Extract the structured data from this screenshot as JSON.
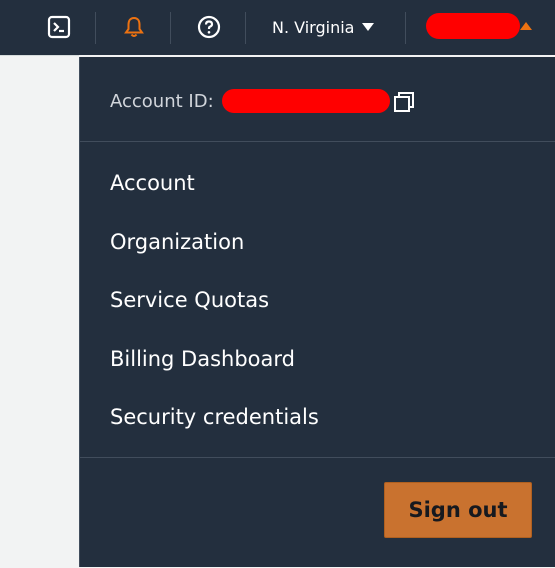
{
  "topbar": {
    "icons": {
      "cloudshell": "terminal-icon",
      "notifications": "bell-icon",
      "help": "help-icon"
    },
    "region_label": "N. Virginia",
    "account_name": "[redacted]",
    "colors": {
      "bar": "#232f3e",
      "accent": "#ec7211"
    }
  },
  "account_menu": {
    "account_id_label": "Account ID:",
    "account_id_value": "[redacted]",
    "items": [
      {
        "label": "Account"
      },
      {
        "label": "Organization"
      },
      {
        "label": "Service Quotas"
      },
      {
        "label": "Billing Dashboard"
      },
      {
        "label": "Security credentials"
      }
    ],
    "sign_out_label": "Sign out"
  }
}
